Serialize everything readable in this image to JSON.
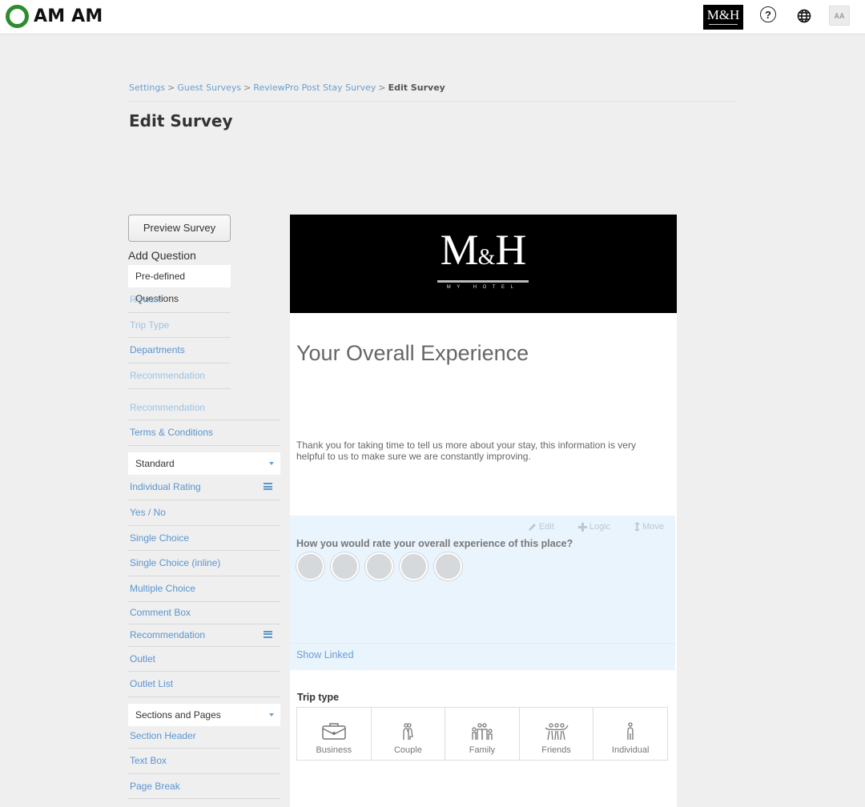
{
  "topbar": {
    "brand_name": "AM AM",
    "hotel_thumb_text": "M&H",
    "help_glyph": "?",
    "font_size_button": "AA",
    "icons": [
      "brand-ring-icon",
      "help-icon",
      "globe-icon"
    ]
  },
  "breadcrumb": {
    "items": [
      "Settings",
      "Guest Surveys",
      "ReviewPro Post Stay Survey"
    ],
    "separator": ">",
    "current": "Edit Survey"
  },
  "page_title": "Edit Survey",
  "sidebar": {
    "preview_button": "Preview Survey",
    "add_question_heading": "Add Question",
    "predefined": {
      "dropdown_label": "Pre-defined Questions",
      "items": [
        {
          "label": "Review",
          "enabled": false
        },
        {
          "label": "Trip Type",
          "enabled": false
        },
        {
          "label": "Departments",
          "enabled": true
        },
        {
          "label": "Recommendation",
          "enabled": false
        },
        {
          "label": "Recommendation",
          "enabled": false
        },
        {
          "label": "Terms & Conditions",
          "enabled": true
        }
      ]
    },
    "standard": {
      "dropdown_label": "Standard",
      "items": [
        {
          "label": "Individual Rating",
          "icon": "stack-icon"
        },
        {
          "label": "Yes / No"
        },
        {
          "label": "Single Choice"
        },
        {
          "label": "Single Choice (inline)"
        },
        {
          "label": "Multiple Choice"
        },
        {
          "label": "Comment Box"
        },
        {
          "label": "Recommendation",
          "icon": "stack-icon"
        },
        {
          "label": "Outlet"
        },
        {
          "label": "Outlet List"
        }
      ]
    },
    "sections": {
      "dropdown_label": "Sections and Pages",
      "items": [
        {
          "label": "Section Header"
        },
        {
          "label": "Text Box"
        },
        {
          "label": "Page Break"
        }
      ]
    }
  },
  "survey": {
    "logo": {
      "left": "M",
      "amp": "&",
      "right": "H",
      "subtitle": "MY HOTEL"
    },
    "section_title": "Your Overall Experience",
    "section_description": "Thank you for taking time to tell us more about your stay, this information is very helpful to us to make sure we are constantly improving.",
    "question": {
      "actions": {
        "edit": "Edit",
        "logic": "Logic",
        "move": "Move"
      },
      "text": "How you would rate your overall experience of this place?",
      "rating_count": 5
    },
    "show_linked": "Show Linked",
    "trip_type": {
      "label": "Trip type",
      "options": [
        {
          "label": "Business",
          "icon": "briefcase-icon"
        },
        {
          "label": "Couple",
          "icon": "couple-icon"
        },
        {
          "label": "Family",
          "icon": "family-icon"
        },
        {
          "label": "Friends",
          "icon": "friends-icon"
        },
        {
          "label": "Individual",
          "icon": "person-icon"
        }
      ]
    }
  },
  "colors": {
    "link": "#5b95cf",
    "link_muted": "#9cc3e6",
    "question_bg": "#eaf4fd",
    "brand_green": "#2e8b2e"
  }
}
